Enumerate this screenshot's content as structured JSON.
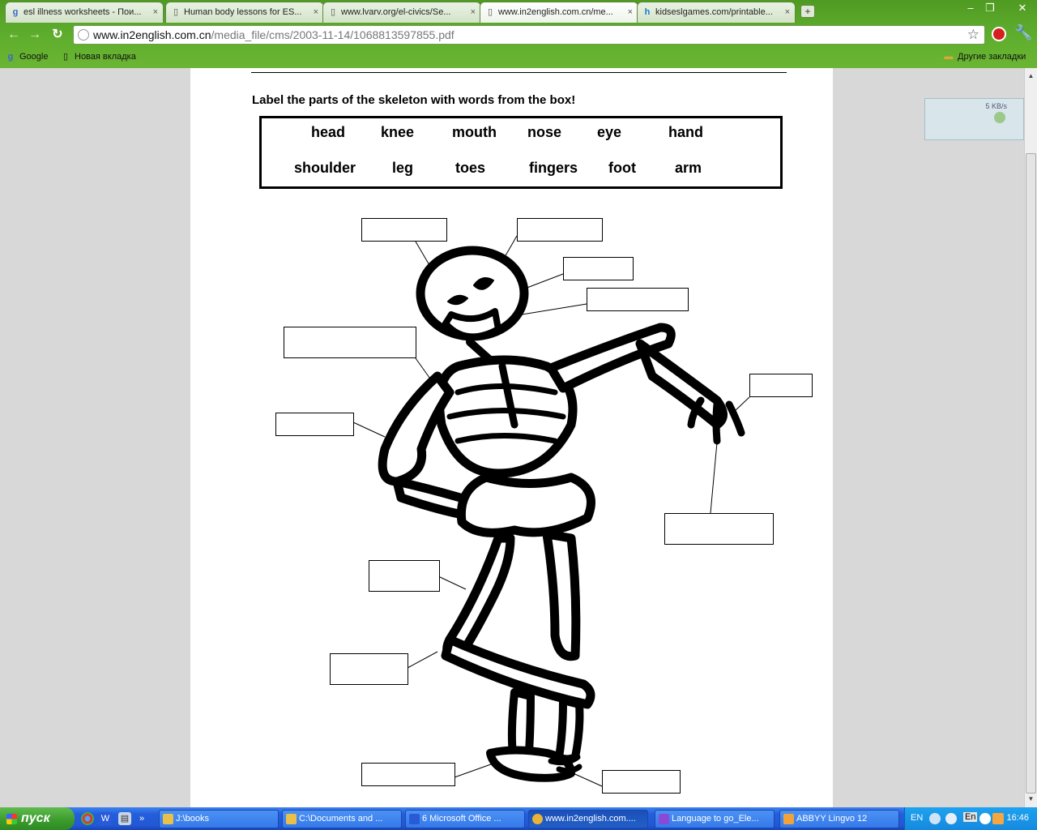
{
  "browser": {
    "tabs": [
      {
        "title": "esl illness worksheets - Пои...",
        "icon": "google-icon"
      },
      {
        "title": "Human body lessons for ES...",
        "icon": "page-icon"
      },
      {
        "title": "www.lvarv.org/el-civics/Se...",
        "icon": "page-icon"
      },
      {
        "title": "www.in2english.com.cn/me...",
        "icon": "page-icon"
      },
      {
        "title": "kidseslgames.com/printable...",
        "icon": "kidseslgames-icon"
      }
    ],
    "close_glyph": "×",
    "new_tab_glyph": "+",
    "url_host": "www.in2english.com.cn",
    "url_path": "/media_file/cms/2003-11-14/1068813597855.pdf",
    "bookmarks": [
      {
        "label": "Google",
        "icon": "google-icon"
      },
      {
        "label": "Новая вкладка",
        "icon": "page-icon"
      }
    ],
    "other_bookmarks": "Другие закладки",
    "download_speed": "5 KB/s"
  },
  "worksheet": {
    "instruction": "Label the parts of the skeleton with words from the box!",
    "words_row1": [
      "head",
      "knee",
      "mouth",
      "nose",
      "eye",
      "hand"
    ],
    "words_row2": [
      "shoulder",
      "leg",
      "toes",
      "fingers",
      "foot",
      "arm"
    ]
  },
  "taskbar": {
    "start_label": "пуск",
    "quicklaunch_more": "»",
    "tasks": [
      {
        "label": "J:\\books",
        "icon_color": "#e8c04a"
      },
      {
        "label": "C:\\Documents and ...",
        "icon_color": "#e8c04a"
      },
      {
        "label": "6 Microsoft Office ...",
        "icon_color": "#2a5bd7"
      },
      {
        "label": "www.in2english.com....",
        "icon_color": "#e9b33a"
      },
      {
        "label": "Language to go_Ele...",
        "icon_color": "#8a4ad8"
      },
      {
        "label": "ABBYY Lingvo 12",
        "icon_color": "#f2a23a"
      }
    ],
    "language": "EN",
    "lang_indicator": "En",
    "clock": "16:46"
  }
}
